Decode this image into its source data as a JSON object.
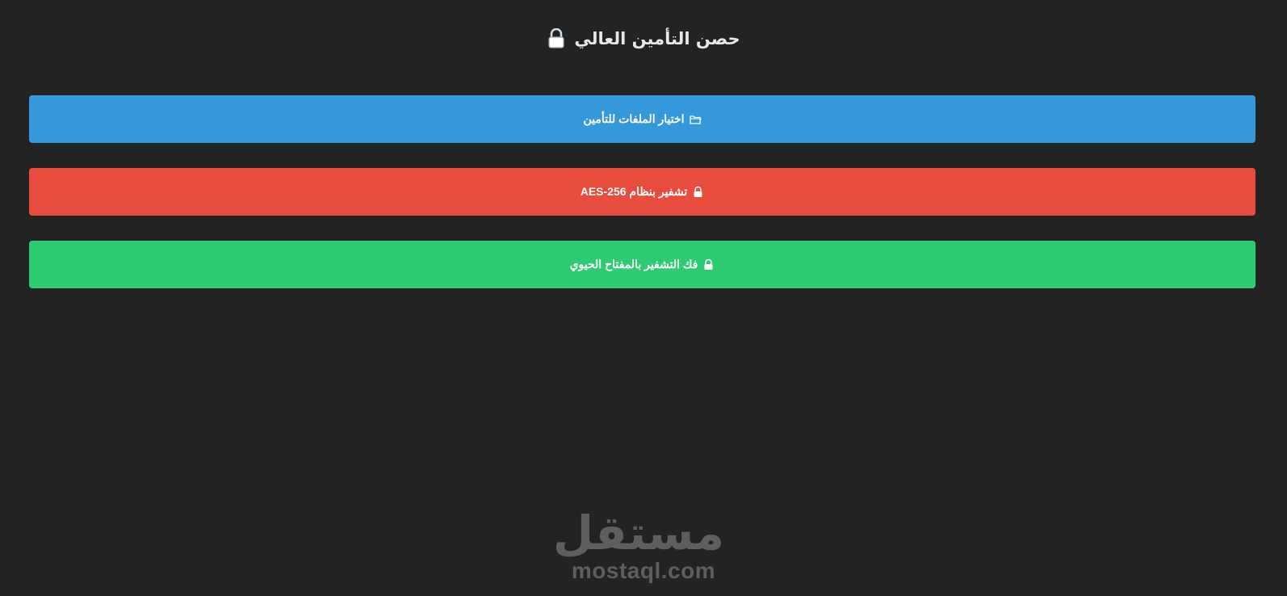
{
  "header": {
    "title": "حصن التأمين العالي",
    "icon": "lock-icon"
  },
  "buttons": {
    "select_files": {
      "label": "اختيار الملفات للتأمين",
      "icon": "folder-icon",
      "color": "#3498db"
    },
    "encrypt": {
      "label": "تشفير بنظام AES-256",
      "icon": "lock-icon",
      "color": "#e74c3c"
    },
    "decrypt": {
      "label": "فك التشفير بالمفتاح الحيوي",
      "icon": "unlock-icon",
      "color": "#2ecc71"
    }
  },
  "watermark": {
    "arabic": "مستقل",
    "latin": "mostaql.com"
  },
  "colors": {
    "background": "#232323"
  }
}
